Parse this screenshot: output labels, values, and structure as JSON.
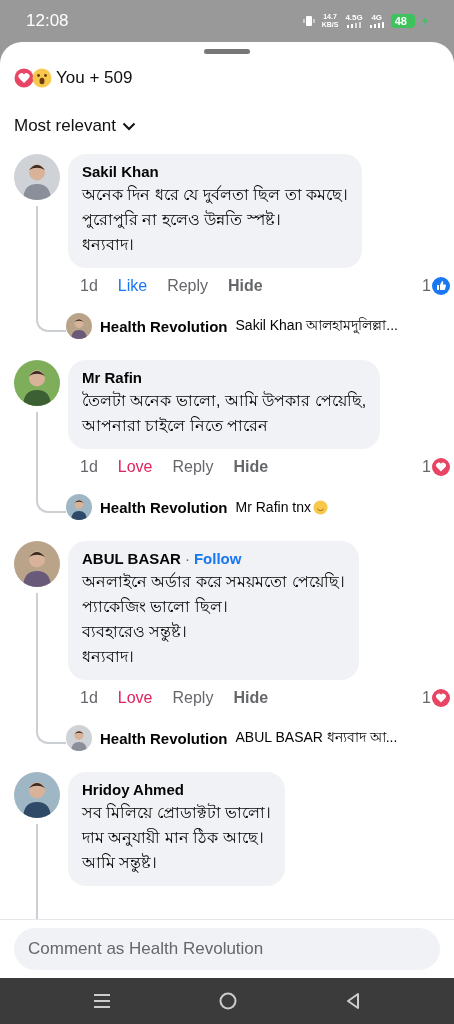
{
  "status_bar": {
    "time": "12:08",
    "net_speed": "14.7",
    "net_unit": "KB/S",
    "network_1": "4.5G",
    "network_2": "4G",
    "battery": "48"
  },
  "reactions": {
    "summary": "You + 509"
  },
  "sort": {
    "label": "Most relevant"
  },
  "comments": [
    {
      "author": "Sakil Khan",
      "body": "অনেক দিন ধরে যে দুর্বলতা ছিল তা কমছে।\nপুরোপুরি না হলেও উন্নতি স্পষ্ট।\nধন্যবাদ।",
      "actions": {
        "time": "1d",
        "reaction_label": "Like",
        "kind": "like",
        "reply": "Reply",
        "hide": "Hide",
        "count": "1"
      },
      "reply": {
        "author": "Health Revolution",
        "text": "Sakil Khan আলহামদুলিল্লা...",
        "emoji": false
      }
    },
    {
      "author": "Mr Rafin",
      "body": "তৈলটা অনেক ভালো,  আমি উপকার পেয়েছি,\nআপনারা চাইলে নিতে পারেন",
      "actions": {
        "time": "1d",
        "reaction_label": "Love",
        "kind": "love",
        "reply": "Reply",
        "hide": "Hide",
        "count": "1"
      },
      "reply": {
        "author": "Health Revolution",
        "text": "Mr Rafin tnx",
        "emoji": true
      }
    },
    {
      "author": "ABUL BASAR",
      "follow": {
        "separator": "·",
        "label": "Follow"
      },
      "body": "অনলাইনে অর্ডার করে সময়মতো পেয়েছি।\nপ্যাকেজিং ভালো ছিল।\nব্যবহারেও সন্তুষ্ট।\nধন্যবাদ।",
      "actions": {
        "time": "1d",
        "reaction_label": "Love",
        "kind": "love",
        "reply": "Reply",
        "hide": "Hide",
        "count": "1"
      },
      "reply": {
        "author": "Health Revolution",
        "text": "ABUL BASAR ধন্যবাদ আ...",
        "emoji": false
      }
    },
    {
      "author": "Hridoy Ahmed",
      "body": "সব মিলিয়ে প্রোডাক্টটা ভালো।\nদাম অনুযায়ী মান ঠিক আছে।\nআমি সন্তুষ্ট।"
    }
  ],
  "composer": {
    "placeholder": "Comment as Health Revolution"
  }
}
